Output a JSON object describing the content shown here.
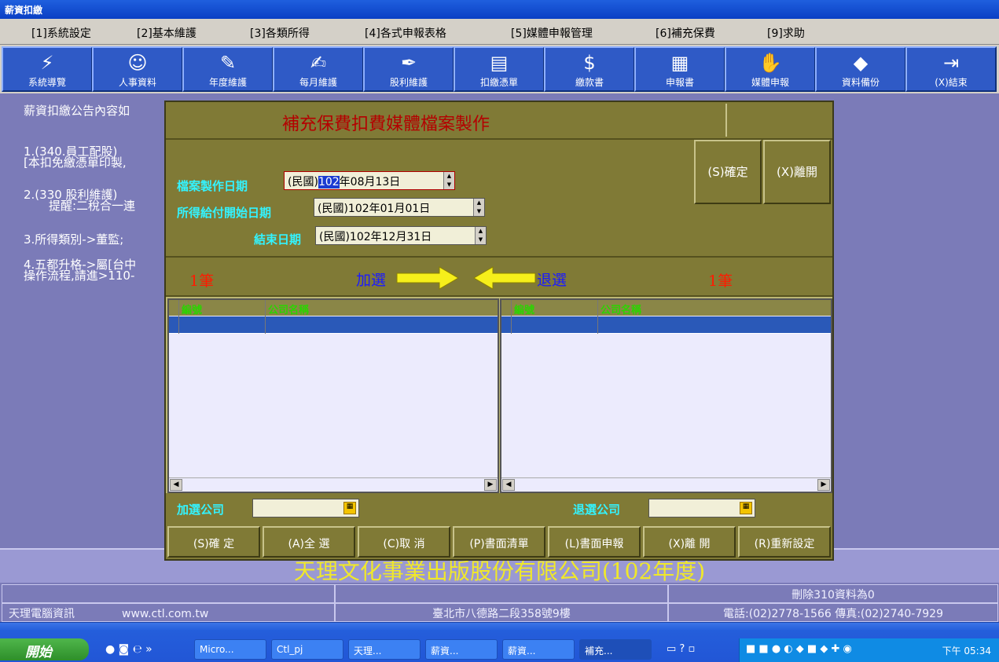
{
  "window": {
    "title": "薪資扣繳"
  },
  "menu": [
    "[1]系統設定",
    "[2]基本維護",
    "[3]各類所得",
    "[4]各式申報表格",
    "[5]媒體申報管理",
    "[6]補充保費",
    "[9]求助"
  ],
  "toolbar": [
    {
      "label": "系統導覽",
      "icon": "lightning-icon"
    },
    {
      "label": "人事資料",
      "icon": "person-icon"
    },
    {
      "label": "年度維護",
      "icon": "notepad-icon"
    },
    {
      "label": "每月維護",
      "icon": "scroll-icon"
    },
    {
      "label": "股利維護",
      "icon": "pen-icon"
    },
    {
      "label": "扣繳憑單",
      "icon": "document-icon"
    },
    {
      "label": "繳款書",
      "icon": "moneybag-icon"
    },
    {
      "label": "申報書",
      "icon": "index-icon"
    },
    {
      "label": "媒體申報",
      "icon": "handshake-icon"
    },
    {
      "label": "資料備份",
      "icon": "book-icon"
    },
    {
      "label": "(X)結束",
      "icon": "exit-icon"
    }
  ],
  "notice": {
    "heading": "薪資扣繳公告內容如",
    "lines": [
      "1.(340.員工配股)",
      "[本扣免繳憑單印製,",
      "2.(330 股利維護)",
      "提醒:二稅合一連",
      "3.所得類別->董監;",
      "4.五都升格->屬[台中",
      "操作流程,請進>110-"
    ]
  },
  "dialog": {
    "title": "補充保費扣費媒體檔案製作",
    "labels": {
      "make_date": "檔案製作日期",
      "pay_start": "所得給付開始日期",
      "pay_end": "結束日期"
    },
    "make_date": {
      "prefix": "(民國)",
      "year": "102",
      "rest": "年08月13日"
    },
    "pay_start": "(民國)102年01月01日",
    "pay_end": "(民國)102年12月31日",
    "confirm_top": "(S)確定",
    "leave_top": "(X)離開",
    "left_count": "1筆",
    "right_count": "1筆",
    "add_label": "加選",
    "remove_label": "退選",
    "columns": [
      "編號",
      "公司名稱"
    ],
    "add_company_label": "加選公司",
    "remove_company_label": "退選公司",
    "buttons": [
      "(S)確 定",
      "(A)全 選",
      "(C)取 消",
      "(P)書面清單",
      "(L)書面申報",
      "(X)離 開",
      "(R)重新設定"
    ]
  },
  "company_banner": "天理文化事業出版股份有限公司(102年度)",
  "status": {
    "delete_info": "刪除310資料為0",
    "vendor": "天理電腦資訊",
    "website": "www.ctl.com.tw",
    "address": "臺北市八德路二段358號9樓",
    "phone": "電話:(02)2778-1566 傳真:(02)2740-7929"
  },
  "taskbar": {
    "start": "開始",
    "tasks": [
      "Micro...",
      "Ctl_pj",
      "天理...",
      "薪資...",
      "薪資...",
      "補充..."
    ],
    "clock": "下午 05:34"
  },
  "colors": {
    "dialog_bg": "#807a36",
    "title_red": "#b40000",
    "label_cyan": "#33f3ff",
    "row_select": "#2a59b8"
  }
}
